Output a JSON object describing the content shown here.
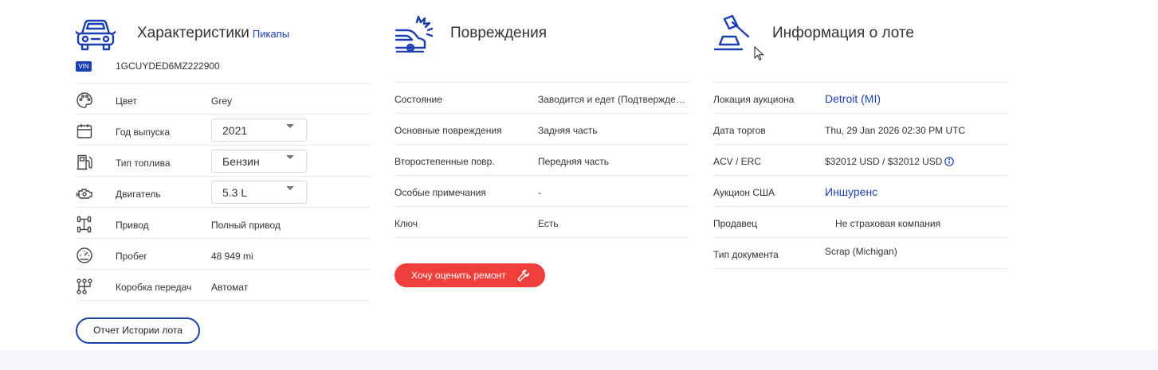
{
  "specs": {
    "title": "Характеристики",
    "category": "Пикапы",
    "vin_badge": "VIN",
    "vin": "1GCUYDED6MZ222900",
    "color_label": "Цвет",
    "color_value": "Grey",
    "year_label": "Год выпуска",
    "year_value": "2021",
    "fuel_label": "Тип топлива",
    "fuel_value": "Бензин",
    "engine_label": "Двигатель",
    "engine_value": "5.3 L",
    "drive_label": "Привод",
    "drive_value": "Полный привод",
    "mileage_label": "Пробег",
    "mileage_value": "48 949 mi",
    "gearbox_label": "Коробка передач",
    "gearbox_value": "Автомат",
    "report_button": "Отчет Истории лота"
  },
  "damage": {
    "title": "Повреждения",
    "condition_label": "Состояние",
    "condition_value": "Заводится и едет (Подтверждено)",
    "primary_label": "Основные повреждения",
    "primary_value": "Задняя часть",
    "secondary_label": "Второстепенные повр.",
    "secondary_value": "Передняя часть",
    "notes_label": "Особые примечания",
    "notes_value": "-",
    "key_label": "Ключ",
    "key_value": "Есть",
    "repair_button": "Хочу оценить ремонт"
  },
  "lot": {
    "title": "Информация о лоте",
    "location_label": "Локация аукциона",
    "location_value": "Detroit (MI)",
    "date_label": "Дата торгов",
    "date_value": "Thu, 29 Jan 2026 02:30 PM UTC",
    "acv_label": "ACV / ERC",
    "acv_value": "$32012 USD / $32012 USD",
    "auction_label": "Аукцион США",
    "auction_value": "Иншуренс",
    "seller_label": "Продавец",
    "seller_value": "Не страховая компания",
    "doc_label": "Тип документа",
    "doc_value": "Scrap (Michigan)"
  },
  "colors": {
    "accent": "#1a3fb0",
    "danger": "#ee3f3a",
    "footer": "#f5f6fa"
  },
  "icons": {
    "specs": "pickup-car-icon",
    "damage": "car-crash-icon",
    "lot": "auction-gavel-icon"
  }
}
